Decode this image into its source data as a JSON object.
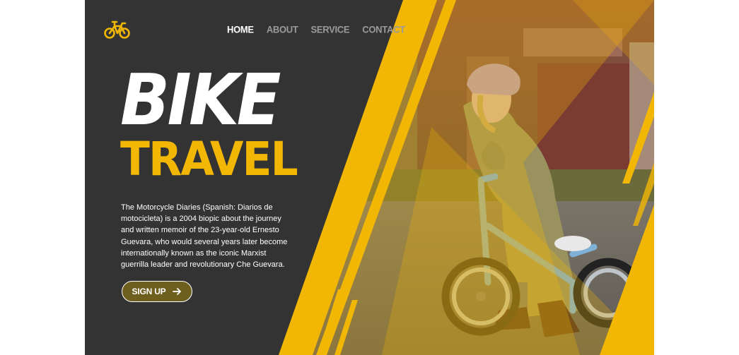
{
  "brand": {
    "logo_icon": "bicycle-icon",
    "accent_color": "#f2b705",
    "dark_color": "#333333"
  },
  "nav": {
    "items": [
      {
        "label": "HOME",
        "active": true
      },
      {
        "label": "ABOUT",
        "active": false
      },
      {
        "label": "SERVICE",
        "active": false
      },
      {
        "label": "CONTACT",
        "active": false
      }
    ]
  },
  "hero": {
    "title_line1": "BIKE",
    "title_line2": "TRAVEL",
    "description": "The Motorcycle Diaries (Spanish: Diarios de motocicleta) is a 2004 biopic about the journey and written memoir of the 23-year-old Ernesto Guevara, who would several years later become internationally known as the iconic Marxist guerrilla leader and revolutionary Che Guevara.",
    "cta_label": "SIGN UP",
    "cta_icon": "arrow-right-icon"
  }
}
